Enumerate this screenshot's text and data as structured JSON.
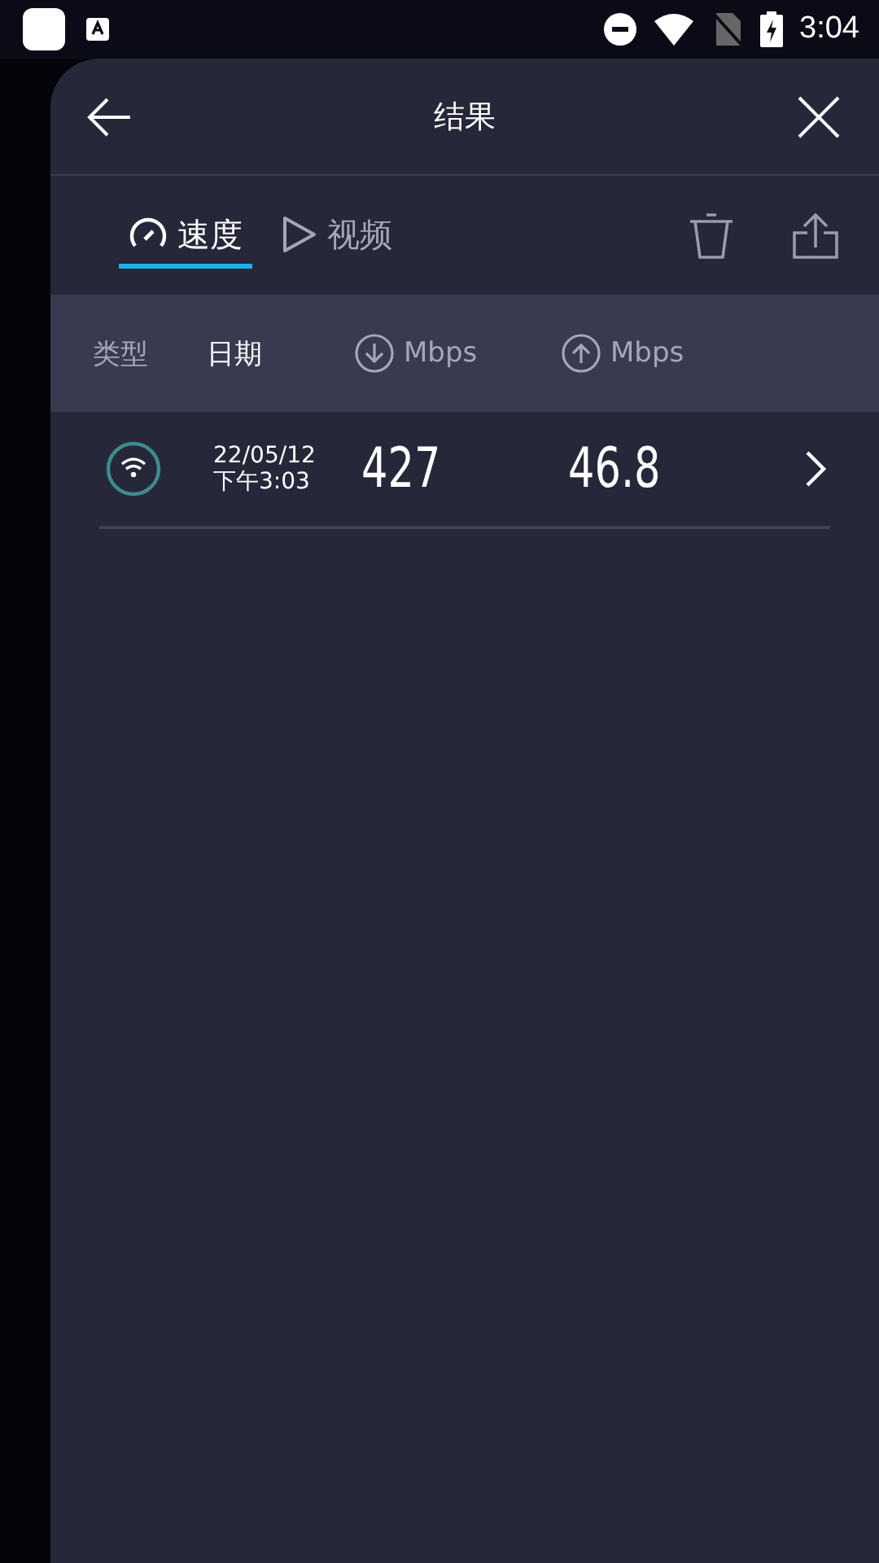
{
  "status_bar": {
    "time": "3:04"
  },
  "header": {
    "title": "结果"
  },
  "tabs": [
    {
      "label": "速度",
      "kind": "speed",
      "selected": true
    },
    {
      "label": "视频",
      "kind": "video",
      "selected": false
    }
  ],
  "columns": [
    {
      "label": "类型",
      "kind": "text",
      "selected": false
    },
    {
      "label": "日期",
      "kind": "text",
      "selected": true
    },
    {
      "label": "Mbps",
      "kind": "download",
      "selected": false
    },
    {
      "label": "Mbps",
      "kind": "upload",
      "selected": false
    }
  ],
  "rows": [
    {
      "kind": "wifi",
      "date": "22/05/12",
      "time": "下午3:03",
      "download": "427",
      "upload": "46.8"
    }
  ]
}
